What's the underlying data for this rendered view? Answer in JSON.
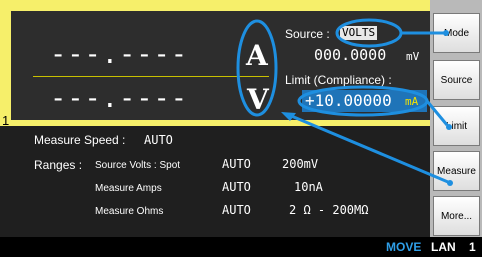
{
  "channel": "1",
  "measure": {
    "primary_value": "---.----",
    "primary_unit": "A",
    "secondary_value": "---.----",
    "secondary_unit": "V"
  },
  "source": {
    "label": "Source :",
    "function": "VOLTS",
    "value": "000.0000",
    "unit": "mV"
  },
  "limit": {
    "label": "Limit (Compliance) :",
    "value": "+10.00000",
    "unit": "mA"
  },
  "settings": {
    "speed_label": "Measure Speed :",
    "speed_value": "AUTO",
    "ranges_label": "Ranges :",
    "rows": [
      {
        "name": "Source Volts : Spot",
        "mode": "AUTO",
        "range": "200mV"
      },
      {
        "name": "Measure Amps",
        "mode": "AUTO",
        "range": "10nA"
      },
      {
        "name": "Measure Ohms",
        "mode": "AUTO",
        "range": "2 Ω - 200MΩ"
      }
    ]
  },
  "softkeys": [
    "Mode",
    "Source",
    "Limit",
    "Measure",
    "More..."
  ],
  "status": {
    "move": "MOVE",
    "lan": "LAN",
    "num": "1"
  },
  "colors": {
    "frame": "#f6ef6a",
    "highlight": "#1f74b8",
    "callout": "#1e8fe0",
    "status_move": "#2f9fe8"
  }
}
